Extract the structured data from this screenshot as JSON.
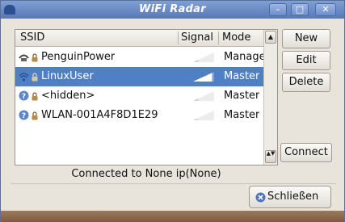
{
  "window": {
    "title": "WiFi Radar",
    "controls": {
      "minimize_glyph": "–",
      "maximize_glyph": "□",
      "close_glyph": "✕"
    }
  },
  "network_list": {
    "columns": {
      "ssid": "SSID",
      "signal": "Signal",
      "mode": "Mode"
    },
    "rows": [
      {
        "ssid": "PenguinPower",
        "mode": "Manage",
        "status_icon": "wired-network-icon",
        "signal": 0.25,
        "selected": false
      },
      {
        "ssid": "LinuxUser",
        "mode": "Master",
        "status_icon": "wireless-network-icon",
        "signal": 0.9,
        "selected": true
      },
      {
        "ssid": "<hidden>",
        "mode": "Master",
        "status_icon": "question-icon",
        "signal": 0.25,
        "selected": false
      },
      {
        "ssid": "WLAN-001A4F8D1E29",
        "mode": "Master",
        "status_icon": "question-icon",
        "signal": 0.2,
        "selected": false
      }
    ],
    "scroll": {
      "up_glyph": "▲",
      "down_glyph": "▲▼"
    }
  },
  "buttons": {
    "new": "New",
    "edit": "Edit",
    "delete": "Delete",
    "connect": "Connect",
    "close": "Schließen"
  },
  "status": {
    "text": "Connected to None ip(None)"
  },
  "colors": {
    "selection": "#4f7fc4",
    "titlebar": "#6a8ac6"
  }
}
